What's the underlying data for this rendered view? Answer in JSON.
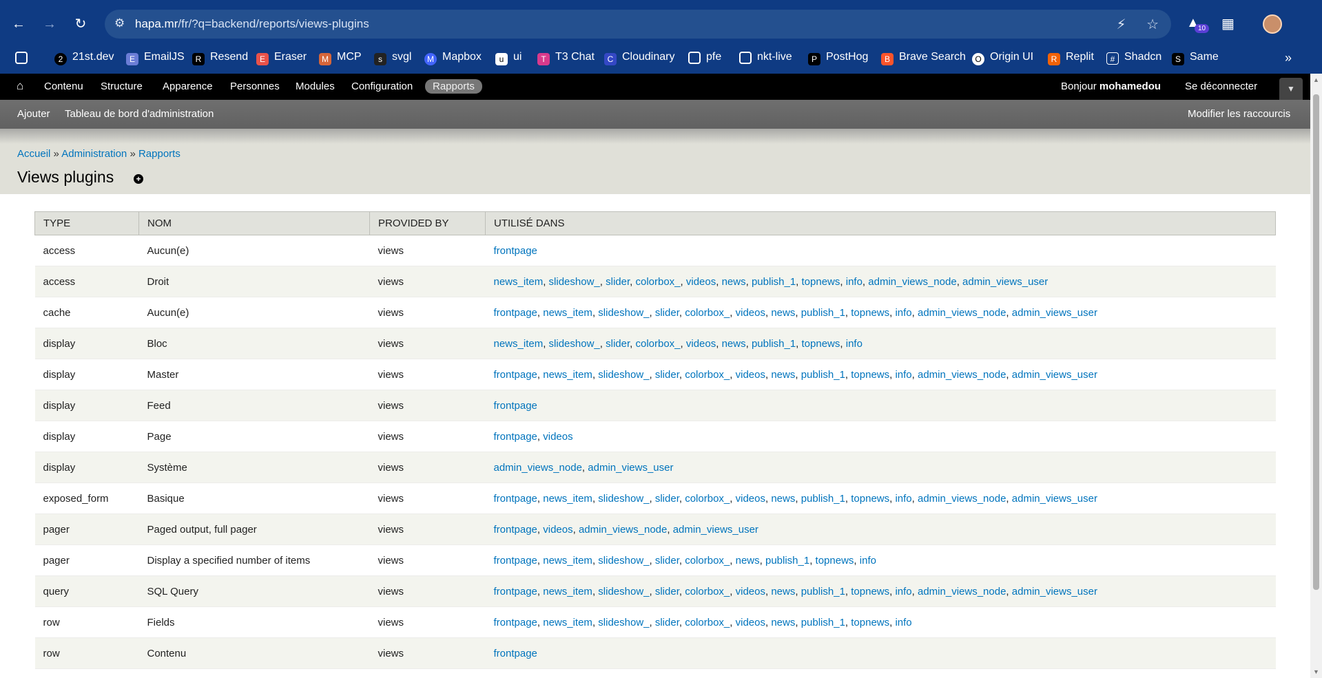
{
  "browser": {
    "url_host": "hapa.mr",
    "url_path": "/fr/?q=backend/reports/views-plugins",
    "extension_badge": "10",
    "bookmarks": [
      "21st.dev",
      "EmailJS",
      "Resend",
      "Eraser",
      "MCP",
      "svgl",
      "Mapbox",
      "ui",
      "T3 Chat",
      "Cloudinary",
      "pfe",
      "nkt-live",
      "PostHog",
      "Brave Search",
      "Origin UI",
      "Replit",
      "Shadcn",
      "Same"
    ]
  },
  "admin_menu": {
    "items": [
      "Contenu",
      "Structure",
      "Apparence",
      "Personnes",
      "Modules",
      "Configuration",
      "Rapports"
    ],
    "active": "Rapports",
    "greeting": "Bonjour",
    "username": "mohamedou",
    "logout": "Se déconnecter"
  },
  "shortcuts": {
    "add": "Ajouter",
    "dashboard": "Tableau de bord d'administration",
    "edit": "Modifier les raccourcis"
  },
  "breadcrumb": [
    "Accueil",
    "Administration",
    "Rapports"
  ],
  "breadcrumb_sep": "»",
  "page_title": "Views plugins",
  "table": {
    "headers": [
      "TYPE",
      "NOM",
      "PROVIDED BY",
      "UTILISÉ DANS"
    ],
    "rows": [
      {
        "type": "access",
        "name": "Aucun(e)",
        "provider": "views",
        "used": [
          "frontpage"
        ]
      },
      {
        "type": "access",
        "name": "Droit",
        "provider": "views",
        "used": [
          "news_item",
          "slideshow_",
          "slider",
          "colorbox_",
          "videos",
          "news",
          "publish_1",
          "topnews",
          "info",
          "admin_views_node",
          "admin_views_user"
        ]
      },
      {
        "type": "cache",
        "name": "Aucun(e)",
        "provider": "views",
        "used": [
          "frontpage",
          "news_item",
          "slideshow_",
          "slider",
          "colorbox_",
          "videos",
          "news",
          "publish_1",
          "topnews",
          "info",
          "admin_views_node",
          "admin_views_user"
        ]
      },
      {
        "type": "display",
        "name": "Bloc",
        "provider": "views",
        "used": [
          "news_item",
          "slideshow_",
          "slider",
          "colorbox_",
          "videos",
          "news",
          "publish_1",
          "topnews",
          "info"
        ]
      },
      {
        "type": "display",
        "name": "Master",
        "provider": "views",
        "used": [
          "frontpage",
          "news_item",
          "slideshow_",
          "slider",
          "colorbox_",
          "videos",
          "news",
          "publish_1",
          "topnews",
          "info",
          "admin_views_node",
          "admin_views_user"
        ]
      },
      {
        "type": "display",
        "name": "Feed",
        "provider": "views",
        "used": [
          "frontpage"
        ]
      },
      {
        "type": "display",
        "name": "Page",
        "provider": "views",
        "used": [
          "frontpage",
          "videos"
        ]
      },
      {
        "type": "display",
        "name": "Système",
        "provider": "views",
        "used": [
          "admin_views_node",
          "admin_views_user"
        ]
      },
      {
        "type": "exposed_form",
        "name": "Basique",
        "provider": "views",
        "used": [
          "frontpage",
          "news_item",
          "slideshow_",
          "slider",
          "colorbox_",
          "videos",
          "news",
          "publish_1",
          "topnews",
          "info",
          "admin_views_node",
          "admin_views_user"
        ]
      },
      {
        "type": "pager",
        "name": "Paged output, full pager",
        "provider": "views",
        "used": [
          "frontpage",
          "videos",
          "admin_views_node",
          "admin_views_user"
        ]
      },
      {
        "type": "pager",
        "name": "Display a specified number of items",
        "provider": "views",
        "used": [
          "frontpage",
          "news_item",
          "slideshow_",
          "slider",
          "colorbox_",
          "news",
          "publish_1",
          "topnews",
          "info"
        ]
      },
      {
        "type": "query",
        "name": "SQL Query",
        "provider": "views",
        "used": [
          "frontpage",
          "news_item",
          "slideshow_",
          "slider",
          "colorbox_",
          "videos",
          "news",
          "publish_1",
          "topnews",
          "info",
          "admin_views_node",
          "admin_views_user"
        ]
      },
      {
        "type": "row",
        "name": "Fields",
        "provider": "views",
        "used": [
          "frontpage",
          "news_item",
          "slideshow_",
          "slider",
          "colorbox_",
          "videos",
          "news",
          "publish_1",
          "topnews",
          "info"
        ]
      },
      {
        "type": "row",
        "name": "Contenu",
        "provider": "views",
        "used": [
          "frontpage"
        ]
      }
    ]
  },
  "colors": {
    "link": "#0074bd",
    "admin_bar": "#000000",
    "chrome": "#0f3b83"
  }
}
